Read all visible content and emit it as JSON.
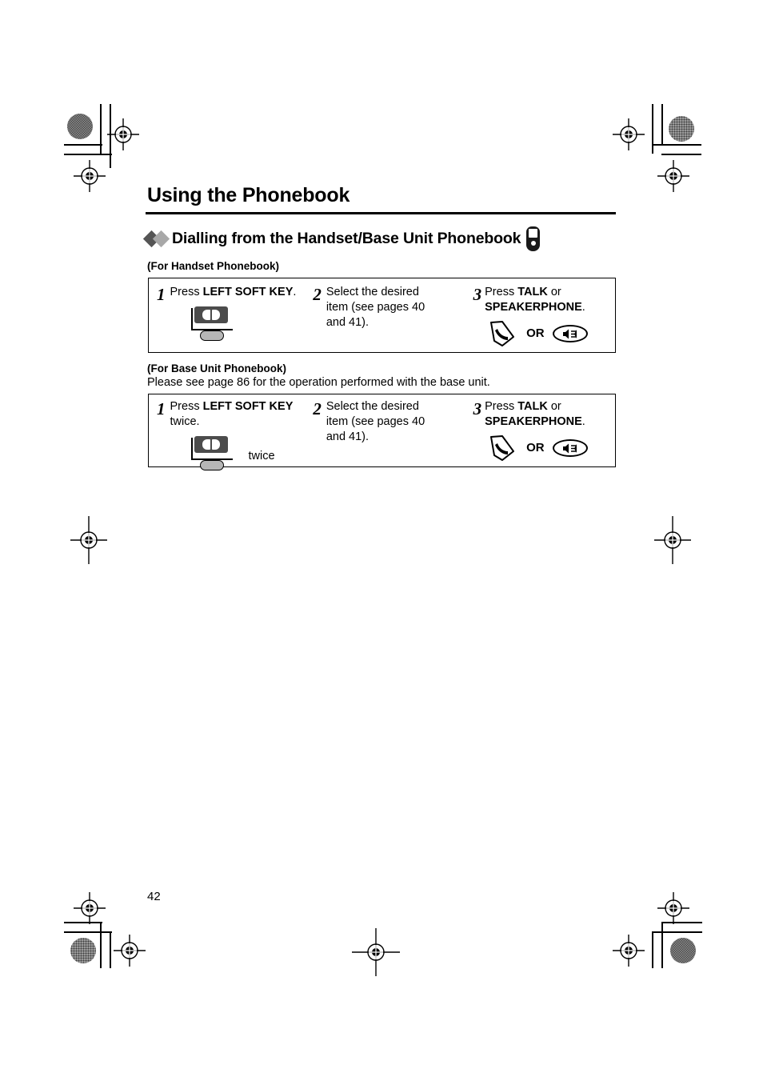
{
  "document": {
    "title": "Using the Phonebook",
    "page_number": "42",
    "section": {
      "heading": "Dialling from the Handset/Base Unit Phonebook",
      "heading_icon": "handset-icon",
      "bullet_icons": [
        "diamond-dark-icon",
        "diamond-light-icon"
      ]
    },
    "handset_section": {
      "label": "(For Handset Phonebook)",
      "steps": [
        {
          "number": "1",
          "text_parts": [
            {
              "text": "Press ",
              "bold": false
            },
            {
              "text": "LEFT SOFT KEY",
              "bold": true
            },
            {
              "text": ".",
              "bold": false
            }
          ],
          "text_plain": "Press LEFT SOFT KEY.",
          "icons": [
            "left-soft-key-icon"
          ]
        },
        {
          "number": "2",
          "text_plain": "Select the desired item (see pages 40 and 41).",
          "icons": []
        },
        {
          "number": "3",
          "text_parts": [
            {
              "text": "Press ",
              "bold": false
            },
            {
              "text": "TALK",
              "bold": true
            },
            {
              "text": " or ",
              "bold": false
            },
            {
              "text": "SPEAKERPHONE",
              "bold": true
            },
            {
              "text": ".",
              "bold": false
            }
          ],
          "text_plain": "Press TALK or SPEAKERPHONE.",
          "icons": [
            "talk-icon",
            "speakerphone-icon"
          ],
          "or_label": "OR"
        }
      ]
    },
    "base_unit_section": {
      "label": "(For Base Unit Phonebook)",
      "note": "Please see page 86 for the operation performed with the base unit.",
      "steps": [
        {
          "number": "1",
          "text_plain": "Press LEFT SOFT KEY twice.",
          "icons": [
            "left-soft-key-icon"
          ],
          "icon_caption": "twice"
        },
        {
          "number": "2",
          "text_plain": "Select the desired item (see pages 40 and 41).",
          "icons": []
        },
        {
          "number": "3",
          "text_plain": "Press TALK or SPEAKERPHONE.",
          "icons": [
            "talk-icon",
            "speakerphone-icon"
          ],
          "or_label": "OR"
        }
      ]
    }
  },
  "labels": {
    "press": "Press ",
    "left_soft_key": "LEFT SOFT KEY",
    "period": ".",
    "twice_suffix": " twice.",
    "select_item": "Select the desired item (see pages 40 and 41).",
    "press2": "Press ",
    "talk": "TALK",
    "or_word": " or ",
    "speakerphone": "SPEAKERPHONE",
    "or_label": "OR",
    "twice": "twice",
    "step1": "1",
    "step2": "2",
    "step3": "3"
  },
  "colors": {
    "text": "#000000",
    "diamond_dark": "#555555",
    "diamond_light": "#a8a8a8",
    "softkey_screen": "#4c4c4c",
    "softkey_button": "#b6b6b6",
    "registration_mark": "#000000"
  }
}
